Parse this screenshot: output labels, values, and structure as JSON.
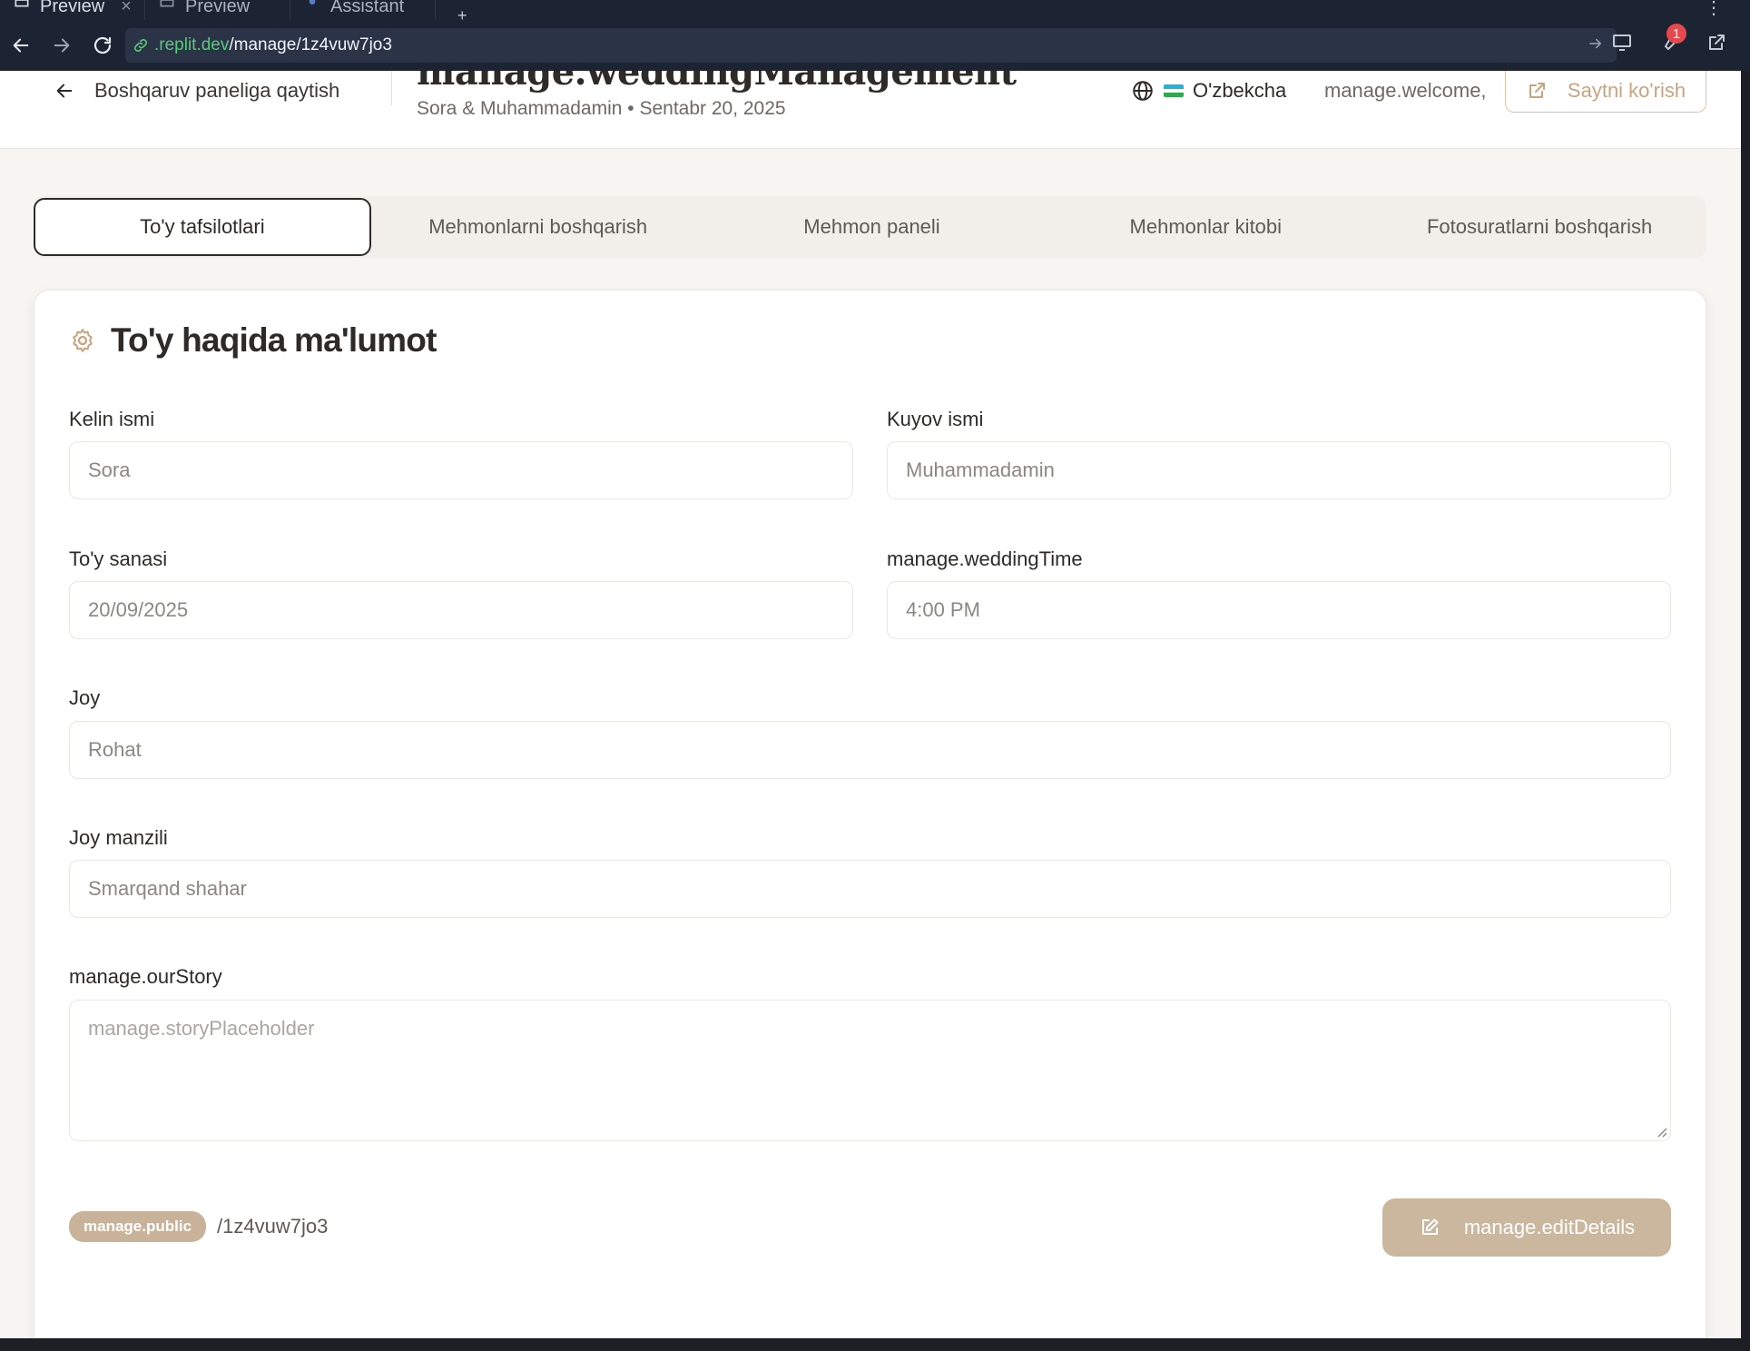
{
  "browser": {
    "tabs": [
      {
        "label": "Preview",
        "active": true
      },
      {
        "label": "Preview",
        "active": false
      },
      {
        "label": "Assistant",
        "active": false
      }
    ],
    "url_domain": ".replit.dev",
    "url_path": "/manage/1z4vuw7jo3",
    "notification_count": "1"
  },
  "header": {
    "back_label": "Boshqaruv paneliga qaytish",
    "title": "manage.weddingManagement",
    "subtitle": "Sora & Muhammadamin • Sentabr 20, 2025",
    "language": "O'zbekcha",
    "welcome": "manage.welcome,",
    "view_site": "Saytni ko'rish"
  },
  "tabs": [
    {
      "label": "To'y tafsilotlari",
      "active": true
    },
    {
      "label": "Mehmonlarni boshqarish",
      "active": false
    },
    {
      "label": "Mehmon paneli",
      "active": false
    },
    {
      "label": "Mehmonlar kitobi",
      "active": false
    },
    {
      "label": "Fotosuratlarni boshqarish",
      "active": false
    }
  ],
  "card": {
    "title": "To'y haqida ma'lumot",
    "bride_label": "Kelin ismi",
    "bride_value": "Sora",
    "groom_label": "Kuyov ismi",
    "groom_value": "Muhammadamin",
    "date_label": "To'y sanasi",
    "date_value": "20/09/2025",
    "time_label": "manage.weddingTime",
    "time_value": "4:00 PM",
    "venue_label": "Joy",
    "venue_value": "Rohat",
    "address_label": "Joy manzili",
    "address_value": "Smarqand shahar",
    "story_label": "manage.ourStory",
    "story_placeholder": "manage.storyPlaceholder",
    "public_badge": "manage.public",
    "slug": "/1z4vuw7jo3",
    "edit_button": "manage.editDetails"
  },
  "colors": {
    "accent": "#cbb79d",
    "accent_text": "#c9a47f",
    "dark": "#2e2a27",
    "url_domain": "#59c97b"
  }
}
